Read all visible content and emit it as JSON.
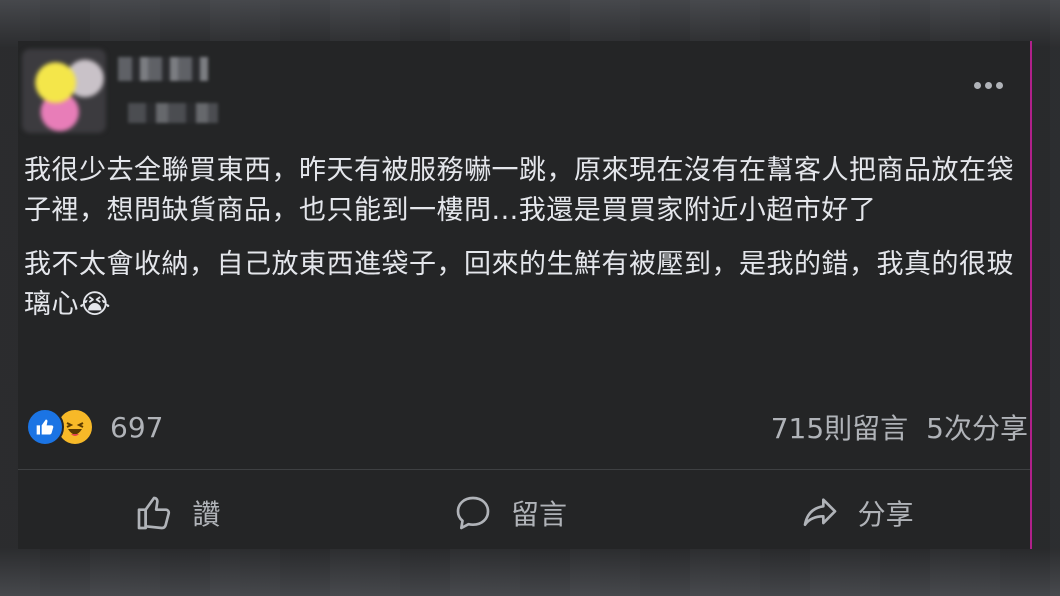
{
  "post": {
    "paragraphs": [
      "我很少去全聯買東西，昨天有被服務嚇一跳，原來現在沒有在幫客人把商品放在袋子裡，想問缺貨商品，也只能到一樓問...我還是買買家附近小超市好了",
      "我不太會收納，自己放東西進袋子，回來的生鮮有被壓到，是我的錯，我真的很玻璃心😭"
    ],
    "reaction_count": "697",
    "comments": "715則留言",
    "shares": "5次分享"
  },
  "actions": {
    "like": "讚",
    "comment": "留言",
    "share": "分享"
  },
  "icons": {
    "more": "more-horizontal-icon",
    "like_reaction": "thumbs-up-icon",
    "haha_reaction": "laughing-face-icon",
    "like_action": "thumbs-up-outline-icon",
    "comment_action": "speech-bubble-icon",
    "share_action": "share-arrow-icon"
  },
  "colors": {
    "card_bg": "#242526",
    "text": "#e4e6eb",
    "secondary_text": "#b0b3b8",
    "like_blue": "#1b74e4",
    "haha_yellow": "#f7b928"
  }
}
